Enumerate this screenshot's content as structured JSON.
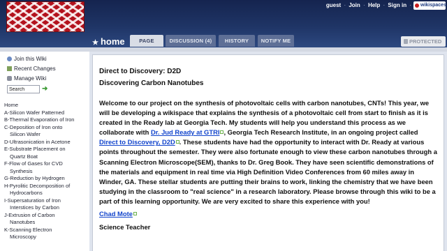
{
  "header": {
    "user_links": [
      "guest",
      "Join",
      "Help",
      "Sign in"
    ],
    "brand": "wikispaces",
    "home": "home",
    "tabs": {
      "page": "PAGE",
      "discussion": "DISCUSSION (4)",
      "history": "HISTORY",
      "notify": "NOTIFY ME"
    },
    "protected": "PROTECTED",
    "colors": {
      "header_bg": "#1f3566",
      "link": "#1144cc",
      "logo_red": "#b3121d"
    }
  },
  "sidebar": {
    "tools": {
      "join": "Join this Wiki",
      "recent": "Recent Changes",
      "manage": "Manage Wiki"
    },
    "search_value": "Search",
    "nav": [
      "Home",
      "A-Silicon Wafer Patterned",
      "B-Thermal Evaporation of Iron",
      "C-Deposition of Iron onto",
      "Silicon Wafer",
      "D-Ultrasonication in Acetone",
      "E-Substrate Placement on",
      "Quartz Boat",
      "F-Flow of Gases for CVD",
      "Synthesis",
      "G-Reduction by Hydrogen",
      "H-Pyrolitic Decomposition of",
      "Hydrocarbons",
      "I-Supersaturation of Iron",
      "Interstices by Carbon",
      "J-Extrusion of Carbon",
      "Nanotubes",
      "K-Scanning Electron",
      "Microscopy"
    ]
  },
  "page": {
    "title": "Direct to Discovery: D2D",
    "subtitle": "Discovering Carbon Nanotubes",
    "body_1": "Welcome to our project on the synthesis of photovoltaic cells with carbon nanotubes, CNTs! This year, we will be developing a wikispace that explains the synthesis of a photovoltaic cell from start to finish as it is created in the Ready lab at Georgia Tech. My students will help you understand this process as we collaborate with ",
    "link_1": "Dr. Jud Ready at GTRI",
    "body_2": ", Georgia Tech Research Institute, in an ongoing project called ",
    "link_2": "Direct to Discovery, D2D",
    "body_3": ". These students have had the opportunity to interact with Dr. Ready at various points throughout the semester. They were also fortunate enough to view these carbon nanotubes through a Scanning Electron Microscope(SEM), thanks to Dr. Greg Book. They have seen scientific demonstrations of the materials and equipment in real time via High Definition Video Conferences from 60 miles away in Winder, GA. These stellar students are putting their brains to work, linking the chemistry that we have been studying in the classroom to \"real science\" in a research laboratory. Please browse through this wiki to be a part of this learning opportunity. We are very excited to share this experience with you!",
    "author_link": "Chad Mote",
    "author_role": "Science Teacher"
  }
}
